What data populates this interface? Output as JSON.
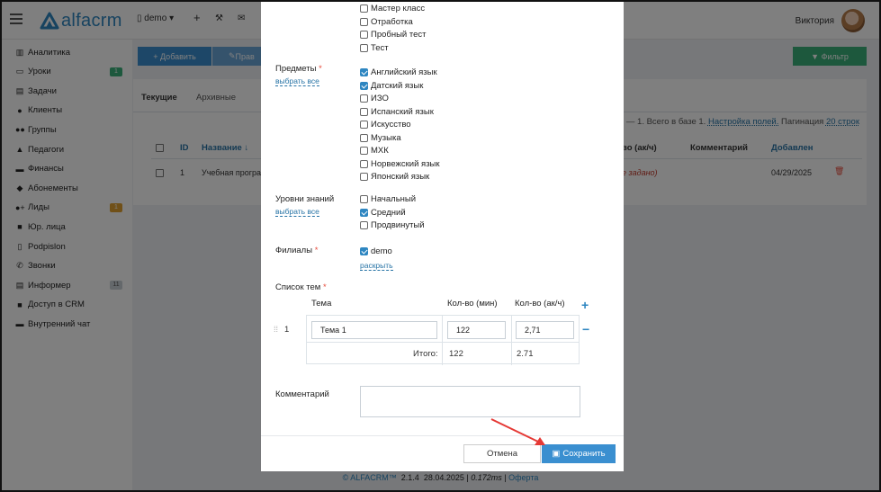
{
  "app": {
    "logo_text": "alfacrm",
    "branch": "demo",
    "user": "Виктория"
  },
  "topbar": {
    "icons": [
      "menu-icon",
      "building-icon",
      "plus-icon",
      "wrench-icon",
      "mail-icon"
    ]
  },
  "sidebar": {
    "items": [
      {
        "icon": "chart-icon",
        "label": "Аналитика",
        "badge": ""
      },
      {
        "icon": "calendar-icon",
        "label": "Уроки",
        "badge": "1",
        "badge_color": "#3bb07a"
      },
      {
        "icon": "tasks-icon",
        "label": "Задачи",
        "badge": ""
      },
      {
        "icon": "user-icon",
        "label": "Клиенты",
        "badge": ""
      },
      {
        "icon": "users-icon",
        "label": "Группы",
        "badge": ""
      },
      {
        "icon": "graduation-cap-icon",
        "label": "Педагоги",
        "badge": ""
      },
      {
        "icon": "money-icon",
        "label": "Финансы",
        "badge": ""
      },
      {
        "icon": "tag-icon",
        "label": "Абонементы",
        "badge": ""
      },
      {
        "icon": "user-plus-icon",
        "label": "Лиды",
        "badge": "1",
        "badge_color": "#e0a030"
      },
      {
        "icon": "briefcase-icon",
        "label": "Юр. лица",
        "badge": ""
      },
      {
        "icon": "document-icon",
        "label": "Podpislon",
        "badge": ""
      },
      {
        "icon": "phone-icon",
        "label": "Звонки",
        "badge": ""
      },
      {
        "icon": "database-icon",
        "label": "Информер",
        "badge": "11",
        "badge_color": "#c9d0d6"
      },
      {
        "icon": "lock-icon",
        "label": "Доступ в CRM",
        "badge": ""
      },
      {
        "icon": "chat-icon",
        "label": "Внутренний чат",
        "badge": ""
      }
    ]
  },
  "main": {
    "add_label": "+ Добавить",
    "edit_label": "Прав",
    "filter_label": "Фильтр",
    "tabs": [
      "Текущие",
      "Архивные"
    ],
    "pagination": {
      "range": "1 — 1. Всего в базе 1.",
      "settings": "Настройка полей.",
      "label": "Пагинация",
      "rows": "20 строк"
    },
    "columns": [
      "ID",
      "Название ↓",
      "во (ак/ч)",
      "Комментарий",
      "Добавлен"
    ],
    "row": {
      "id": "1",
      "name": "Учебная програ",
      "kol": "е задано)",
      "added": "04/29/2025"
    }
  },
  "modal": {
    "top_options": [
      {
        "label": "Мастер класс",
        "checked": false
      },
      {
        "label": "Отработка",
        "checked": false
      },
      {
        "label": "Пробный тест",
        "checked": false
      },
      {
        "label": "Тест",
        "checked": false
      }
    ],
    "subjects": {
      "label": "Предметы",
      "required": "*",
      "select_all": "выбрать все",
      "options": [
        {
          "label": "Английский язык",
          "checked": true
        },
        {
          "label": "Датский язык",
          "checked": true
        },
        {
          "label": "ИЗО",
          "checked": false
        },
        {
          "label": "Испанский язык",
          "checked": false
        },
        {
          "label": "Искусство",
          "checked": false
        },
        {
          "label": "Музыка",
          "checked": false
        },
        {
          "label": "МХК",
          "checked": false
        },
        {
          "label": "Норвежский язык",
          "checked": false
        },
        {
          "label": "Японский язык",
          "checked": false
        }
      ]
    },
    "levels": {
      "label": "Уровни знаний",
      "select_all": "выбрать все",
      "options": [
        {
          "label": "Начальный",
          "checked": false
        },
        {
          "label": "Средний",
          "checked": true
        },
        {
          "label": "Продвинутый",
          "checked": false
        }
      ]
    },
    "branches": {
      "label": "Филиалы",
      "required": "*",
      "options": [
        {
          "label": "demo",
          "checked": true
        }
      ],
      "expand": "раскрыть"
    },
    "topics": {
      "label": "Список тем",
      "required": "*",
      "headers": {
        "topic": "Тема",
        "minutes": "Кол-во (мин)",
        "ak": "Кол-во (ак/ч)"
      },
      "rows": [
        {
          "num": "1",
          "topic": "Тема 1",
          "minutes": "122",
          "ak": "2,71"
        }
      ],
      "total_label": "Итого:",
      "total_minutes": "122",
      "total_ak": "2.71"
    },
    "comment_label": "Комментарий",
    "cancel": "Отмена",
    "save": "Сохранить"
  },
  "footer": {
    "copyright": "© ALFACRM™",
    "version": "2.1.4",
    "date": "28.04.2025",
    "sep1": "|",
    "timing": "0.172ms",
    "sep2": "|",
    "offer": "Оферта"
  }
}
